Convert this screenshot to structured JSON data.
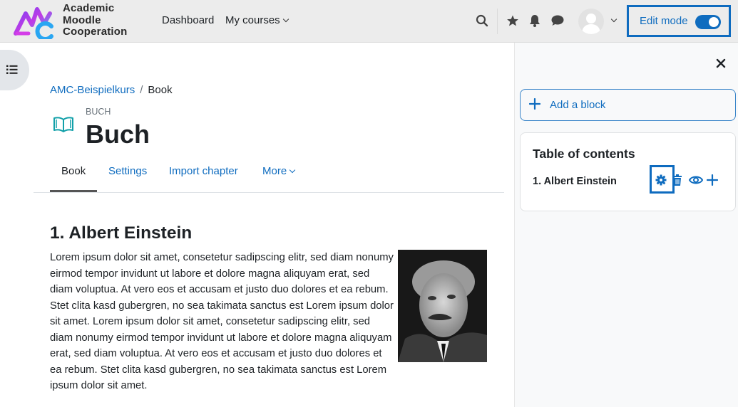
{
  "navbar": {
    "logo_text": [
      "Academic",
      "Moodle",
      "Cooperation"
    ],
    "links": [
      {
        "label": "Dashboard"
      },
      {
        "label": "My courses",
        "has_dropdown": true
      }
    ],
    "icons": [
      "search-icon",
      "star-icon",
      "bell-icon",
      "chat-icon"
    ],
    "edit_mode": {
      "label": "Edit mode",
      "enabled": true
    }
  },
  "breadcrumb": {
    "items": [
      {
        "label": "AMC-Beispielkurs",
        "link": true
      },
      {
        "label": "Book",
        "link": false
      }
    ],
    "separator": "/"
  },
  "header": {
    "module_type": "BUCH",
    "title": "Buch"
  },
  "tabs": [
    {
      "label": "Book",
      "active": true
    },
    {
      "label": "Settings"
    },
    {
      "label": "Import chapter"
    },
    {
      "label": "More",
      "has_dropdown": true
    }
  ],
  "chapter": {
    "title": "1. Albert Einstein",
    "text": "Lorem ipsum dolor sit amet, consetetur sadipscing elitr, sed diam nonumy eirmod tempor invidunt ut labore et dolore magna aliquyam erat, sed diam voluptua. At vero eos et accusam et justo duo dolores et ea rebum. Stet clita kasd gubergren, no sea takimata sanctus est Lorem ipsum dolor sit amet. Lorem ipsum dolor sit amet, consetetur sadipscing elitr, sed diam nonumy eirmod tempor invidunt ut labore et dolore magna aliquyam erat, sed diam voluptua. At vero eos et accusam et justo duo dolores et ea rebum. Stet clita kasd gubergren, no sea takimata sanctus est Lorem ipsum dolor sit amet.",
    "image_alt": "Portrait of Albert Einstein"
  },
  "right_drawer": {
    "add_block_label": "Add a block",
    "toc": {
      "title": "Table of contents",
      "items": [
        {
          "label": "1. Albert Einstein",
          "actions": [
            "gear-icon",
            "trash-icon",
            "eye-icon",
            "plus-icon"
          ]
        }
      ]
    }
  },
  "colors": {
    "primary": "#0f6cbf",
    "highlight_border": "#0e6bbf",
    "navbar_bg": "#ececec",
    "drawer_bg": "#f8f9fa",
    "module_icon": "#12a0a9"
  }
}
